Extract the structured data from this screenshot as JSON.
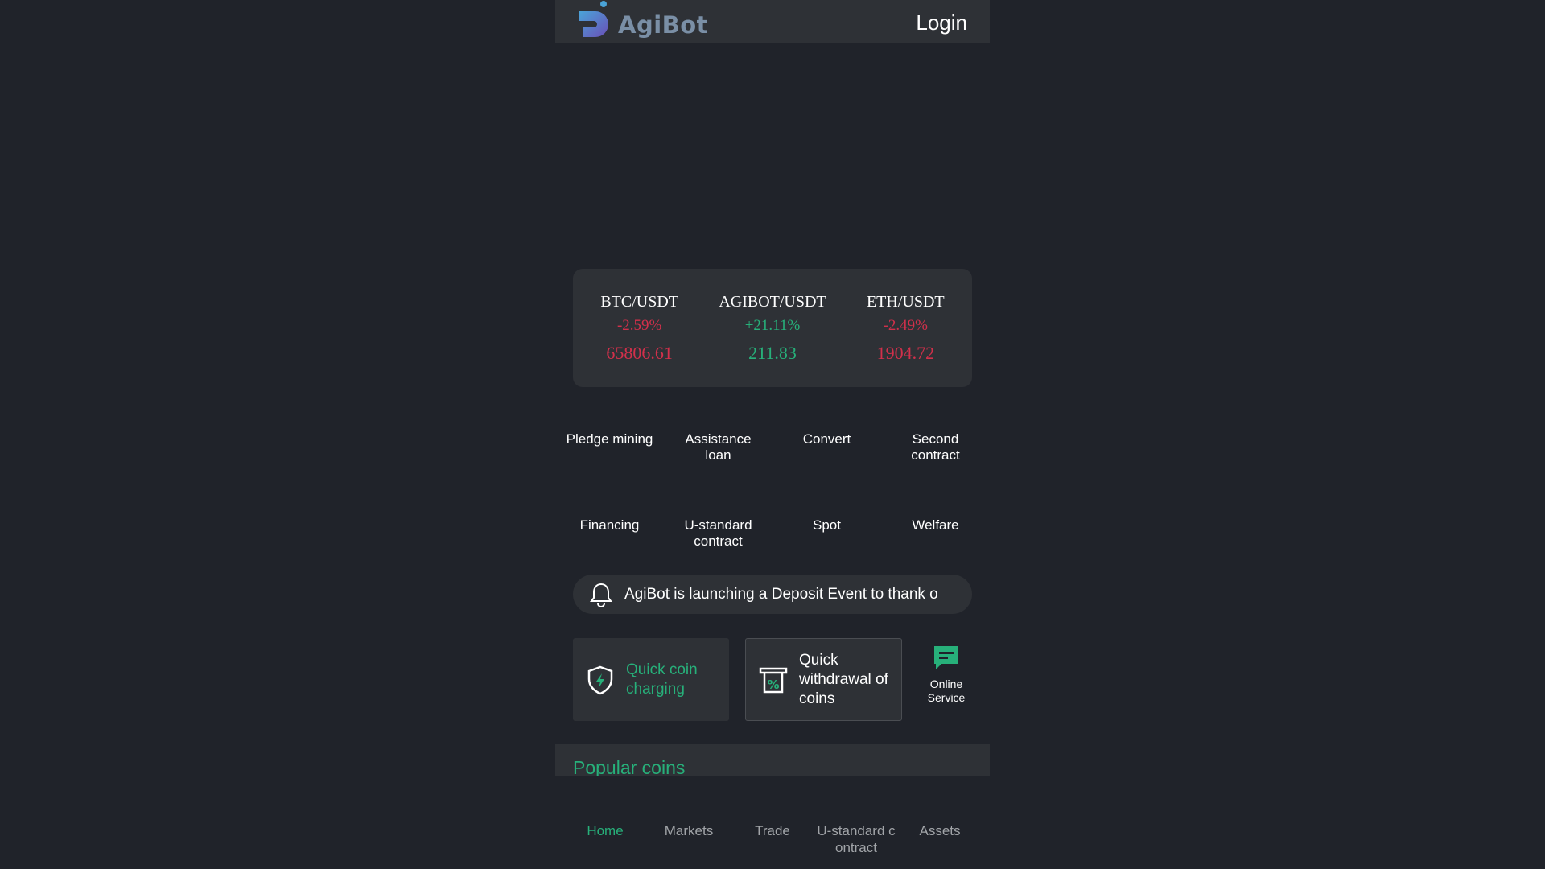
{
  "header": {
    "logo_text": "AgiBot",
    "login_label": "Login"
  },
  "tickers": [
    {
      "pair": "BTC/USDT",
      "change": "-2.59%",
      "price": "65806.61",
      "direction": "down"
    },
    {
      "pair": "AGIBOT/USDT",
      "change": "+21.11%",
      "price": "211.83",
      "direction": "up"
    },
    {
      "pair": "ETH/USDT",
      "change": "-2.49%",
      "price": "1904.72",
      "direction": "down"
    }
  ],
  "menu": [
    {
      "label": "Pledge mining"
    },
    {
      "label": "Assistance loan"
    },
    {
      "label": "Convert"
    },
    {
      "label": "Second contract"
    },
    {
      "label": "Financing"
    },
    {
      "label": "U-standard contract"
    },
    {
      "label": "Spot"
    },
    {
      "label": "Welfare"
    }
  ],
  "notice": {
    "icon": "bell-icon",
    "text": "AgiBot is launching a Deposit Event to thank o"
  },
  "quick": {
    "charge_label": "Quick coin charging",
    "withdraw_label": "Quick withdrawal of coins",
    "service_label": "Online Service"
  },
  "popular": {
    "title": "Popular coins"
  },
  "tabs": [
    {
      "label": "Home",
      "active": true
    },
    {
      "label": "Markets",
      "active": false
    },
    {
      "label": "Trade",
      "active": false
    },
    {
      "label": "U-standard c ontract",
      "active": false
    },
    {
      "label": "Assets",
      "active": false
    }
  ],
  "colors": {
    "background": "#20232a",
    "card": "#2e3136",
    "positive": "#27b07a",
    "negative": "#d2304b",
    "muted": "#a1a4a8"
  }
}
